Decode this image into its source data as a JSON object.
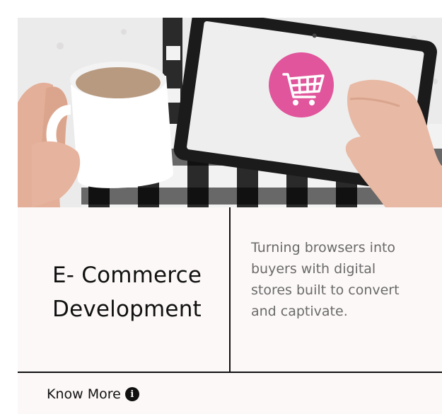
{
  "card": {
    "image_alt": "Hands holding a coffee mug and a tablet showing a shopping cart icon",
    "title_lines": [
      "E- Commerce",
      "Development"
    ],
    "description_lines": [
      "Turning browsers into",
      "buyers with digital",
      "stores built to convert",
      "and captivate."
    ],
    "cta_label": "Know More",
    "cta_icon": "info-icon"
  },
  "colors": {
    "card_background": "#fcf8f7",
    "title_text": "#111111",
    "description_text": "#6a6a6a",
    "border": "#111111",
    "cart_badge": "#e0559b"
  }
}
